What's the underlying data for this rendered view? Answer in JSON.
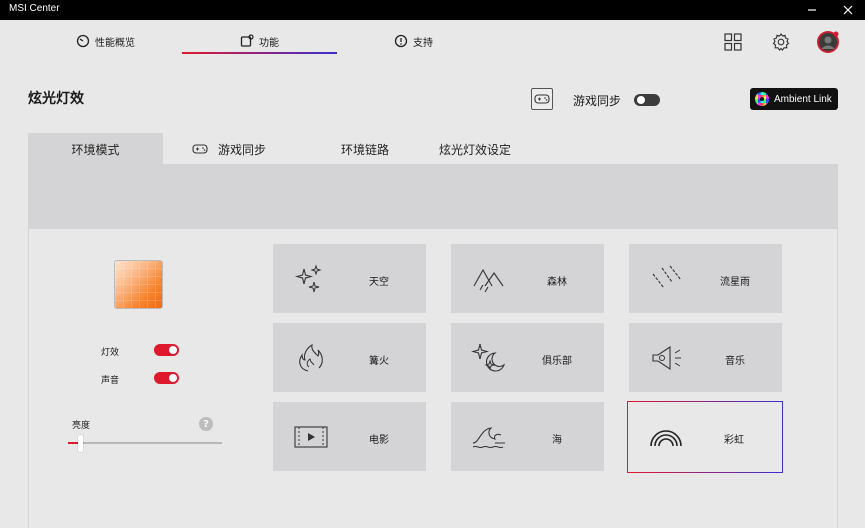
{
  "window": {
    "title": "MSI Center"
  },
  "nav": {
    "tabs": [
      {
        "label": "性能概览"
      },
      {
        "label": "功能"
      },
      {
        "label": "支持"
      }
    ]
  },
  "header": {
    "title": "炫光灯效",
    "sync_label": "游戏同步",
    "ambient_label": "Ambient Link"
  },
  "tabs": [
    {
      "label": "环境模式"
    },
    {
      "label": "游戏同步"
    },
    {
      "label": "环境链路"
    },
    {
      "label": "炫光灯效设定"
    }
  ],
  "controls": {
    "light_label": "灯效",
    "sound_label": "声音",
    "brightness_label": "亮度",
    "help": "?",
    "brightness_value": 0.08
  },
  "effects": [
    {
      "label": "天空",
      "icon": "sparkles-icon"
    },
    {
      "label": "森林",
      "icon": "forest-icon"
    },
    {
      "label": "流星雨",
      "icon": "meteor-icon"
    },
    {
      "label": "篝火",
      "icon": "campfire-icon"
    },
    {
      "label": "俱乐部",
      "icon": "club-icon"
    },
    {
      "label": "音乐",
      "icon": "music-icon"
    },
    {
      "label": "电影",
      "icon": "film-icon"
    },
    {
      "label": "海",
      "icon": "wave-icon"
    },
    {
      "label": "彩虹",
      "icon": "rainbow-icon"
    }
  ],
  "colors": {
    "accent_red": "#e0182d",
    "accent_blue": "#3a2fd0"
  }
}
